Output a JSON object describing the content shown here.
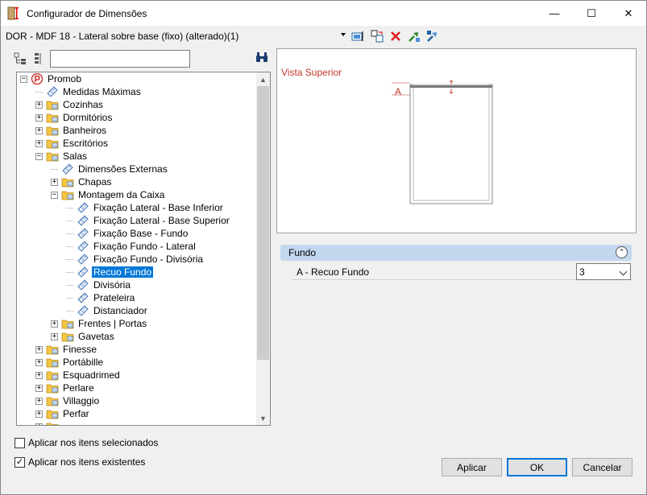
{
  "window": {
    "title": "Configurador de Dimensões",
    "minimize_glyph": "—",
    "maximize_glyph": "☐",
    "close_glyph": "✕"
  },
  "toolbar": {
    "document_title": "DOR - MDF 18 - Lateral sobre base (fixo) (alterado)(1)",
    "icons": [
      "select-item-icon",
      "copy-dimension-icon",
      "delete-icon",
      "export-icon",
      "import-icon"
    ]
  },
  "tree_toolbar": {
    "icons": [
      "expand-tree-icon",
      "collapse-tree-icon",
      "binoculars-icon"
    ],
    "search_value": ""
  },
  "tree": {
    "items": [
      {
        "label": "Promob",
        "level": 0,
        "expander": "−",
        "icon": "promob-logo-icon"
      },
      {
        "label": "Medidas Máximas",
        "level": 1,
        "expander": "",
        "icon": "tape-icon"
      },
      {
        "label": "Cozinhas",
        "level": 1,
        "expander": "+",
        "icon": "folder-icon"
      },
      {
        "label": "Dormitórios",
        "level": 1,
        "expander": "+",
        "icon": "folder-icon"
      },
      {
        "label": "Banheiros",
        "level": 1,
        "expander": "+",
        "icon": "folder-icon"
      },
      {
        "label": "Escritórios",
        "level": 1,
        "expander": "+",
        "icon": "folder-icon"
      },
      {
        "label": "Salas",
        "level": 1,
        "expander": "−",
        "icon": "folder-icon"
      },
      {
        "label": "Dimensões Externas",
        "level": 2,
        "expander": "",
        "icon": "tape-icon"
      },
      {
        "label": "Chapas",
        "level": 2,
        "expander": "+",
        "icon": "folder-icon"
      },
      {
        "label": "Montagem da Caixa",
        "level": 2,
        "expander": "−",
        "icon": "folder-icon"
      },
      {
        "label": "Fixação Lateral - Base Inferior",
        "level": 3,
        "expander": "",
        "icon": "tape-icon"
      },
      {
        "label": "Fixação Lateral - Base Superior",
        "level": 3,
        "expander": "",
        "icon": "tape-icon"
      },
      {
        "label": "Fixação Base - Fundo",
        "level": 3,
        "expander": "",
        "icon": "tape-icon"
      },
      {
        "label": "Fixação Fundo - Lateral",
        "level": 3,
        "expander": "",
        "icon": "tape-icon"
      },
      {
        "label": "Fixação Fundo - Divisória",
        "level": 3,
        "expander": "",
        "icon": "tape-icon"
      },
      {
        "label": "Recuo Fundo",
        "level": 3,
        "expander": "",
        "icon": "tape-icon",
        "selected": true
      },
      {
        "label": "Divisória",
        "level": 3,
        "expander": "",
        "icon": "tape-icon"
      },
      {
        "label": "Prateleira",
        "level": 3,
        "expander": "",
        "icon": "tape-icon"
      },
      {
        "label": "Distanciador",
        "level": 3,
        "expander": "",
        "icon": "tape-icon"
      },
      {
        "label": "Frentes | Portas",
        "level": 2,
        "expander": "+",
        "icon": "folder-icon"
      },
      {
        "label": "Gavetas",
        "level": 2,
        "expander": "+",
        "icon": "folder-icon"
      },
      {
        "label": "Finesse",
        "level": 1,
        "expander": "+",
        "icon": "folder-icon"
      },
      {
        "label": "Portábille",
        "level": 1,
        "expander": "+",
        "icon": "folder-icon"
      },
      {
        "label": "Esquadrimed",
        "level": 1,
        "expander": "+",
        "icon": "folder-icon"
      },
      {
        "label": "Perlare",
        "level": 1,
        "expander": "+",
        "icon": "folder-icon"
      },
      {
        "label": "Villaggio",
        "level": 1,
        "expander": "+",
        "icon": "folder-icon"
      },
      {
        "label": "Perfar",
        "level": 1,
        "expander": "+",
        "icon": "folder-icon"
      },
      {
        "label": "",
        "level": 1,
        "expander": "+",
        "icon": "folder-icon"
      }
    ]
  },
  "preview": {
    "view_label": "Vista Superior",
    "dimension_marker": "A"
  },
  "properties": {
    "group_label": "Fundo",
    "rows": [
      {
        "label": "A - Recuo Fundo",
        "value": "3"
      }
    ]
  },
  "options": {
    "apply_selected_label": "Aplicar nos itens selecionados",
    "apply_selected_checked": false,
    "apply_existing_label": "Aplicar nos itens existentes",
    "apply_existing_checked": true
  },
  "buttons": {
    "apply_label": "Aplicar",
    "ok_label": "OK",
    "cancel_label": "Cancelar"
  },
  "colors": {
    "selection": "#0078d7",
    "view_label": "#c0392b",
    "group_header": "#c2d8ef",
    "folder": "#f5c542"
  }
}
